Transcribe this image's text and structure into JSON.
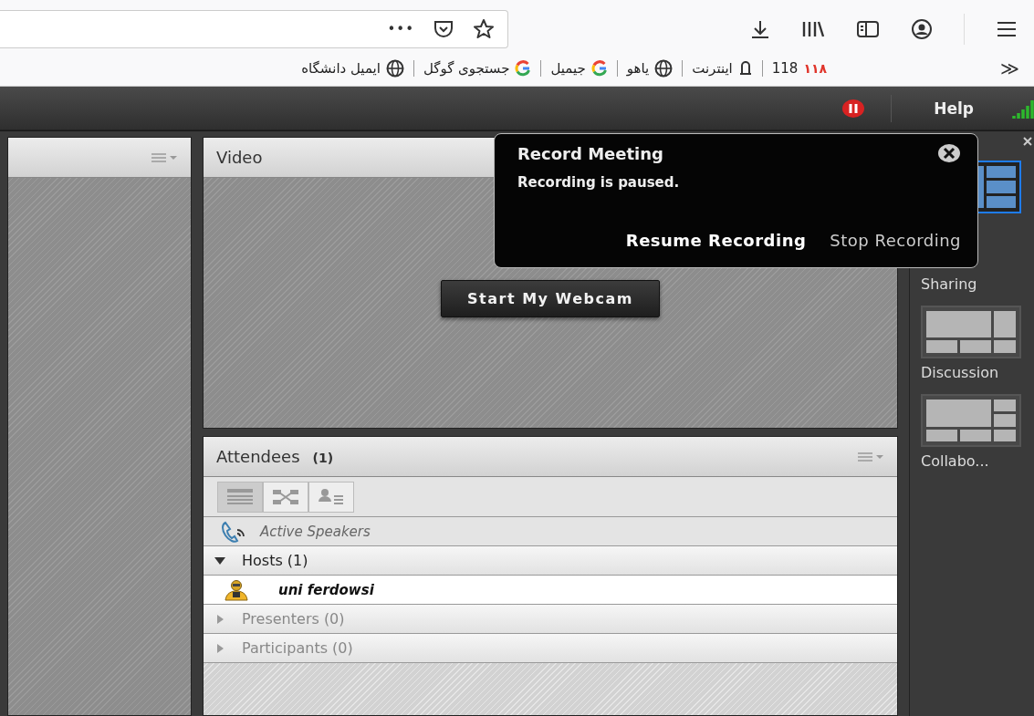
{
  "browser": {
    "url_menu": "•••",
    "bookmarks": [
      {
        "label": "118",
        "favicon_text": "۱۱۸",
        "kind": "text"
      },
      {
        "label": "اینترنت",
        "kind": "bell"
      },
      {
        "label": "یاهو",
        "kind": "globe"
      },
      {
        "label": "جیمیل",
        "kind": "google"
      },
      {
        "label": "جستجوی گوگل",
        "kind": "google"
      },
      {
        "label": "ایمیل دانشگاه",
        "kind": "globe"
      }
    ],
    "overflow": "≫"
  },
  "app_bar": {
    "recording_paused": true,
    "help": "Help"
  },
  "video_panel": {
    "title": "Video",
    "webcam_button": "Start My Webcam"
  },
  "attendees_panel": {
    "title": "Attendees",
    "count": "(1)",
    "views": [
      {
        "kind": "list",
        "selected": true
      },
      {
        "kind": "breakout",
        "selected": false
      },
      {
        "kind": "status",
        "selected": false
      }
    ],
    "active_speakers": "Active Speakers",
    "groups": [
      {
        "label": "Hosts (1)",
        "expanded": true,
        "disabled": false,
        "children": [
          {
            "name": "uni ferdowsi"
          }
        ]
      },
      {
        "label": "Presenters (0)",
        "expanded": false,
        "disabled": true
      },
      {
        "label": "Participants (0)",
        "expanded": false,
        "disabled": true
      }
    ]
  },
  "layouts": [
    {
      "label": "Sharing",
      "kind": "sharing",
      "selected": true
    },
    {
      "label": "Discussion",
      "kind": "discussion",
      "selected": false
    },
    {
      "label": "Collabo...",
      "kind": "collaboration",
      "selected": false
    }
  ],
  "record_dialog": {
    "title": "Record Meeting",
    "message": "Recording is paused.",
    "actions": [
      {
        "label": "Resume Recording",
        "primary": true
      },
      {
        "label": "Stop Recording",
        "primary": false
      }
    ]
  }
}
